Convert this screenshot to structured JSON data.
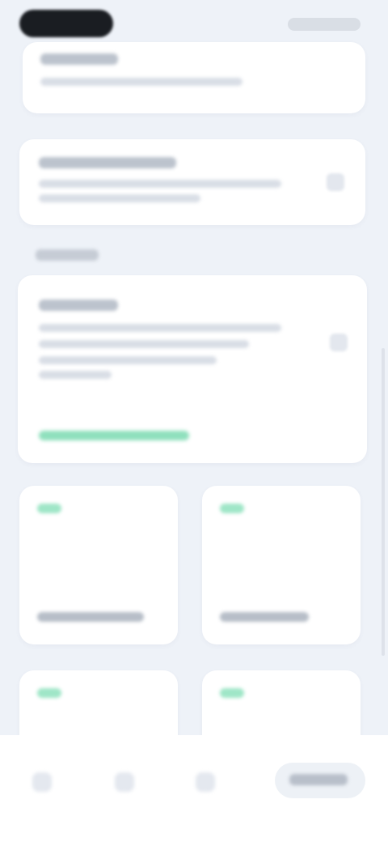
{
  "status_bar": {
    "time_pill": "",
    "icons": [
      "signal-icon",
      "wifi-icon",
      "battery-icon"
    ]
  },
  "cards": [
    {
      "title": "",
      "subtitle": ""
    },
    {
      "title": "",
      "subtitle": "",
      "chevron": "chevron-icon"
    }
  ],
  "section": {
    "label": ""
  },
  "wallet_card": {
    "title": "",
    "description": "",
    "link": ""
  },
  "tiles": [
    {
      "tag": "",
      "title": ""
    },
    {
      "tag": "",
      "title": ""
    },
    {
      "tag": "",
      "title": ""
    },
    {
      "tag": "",
      "title": ""
    }
  ],
  "bottom_nav": {
    "items": [
      "home-icon",
      "chart-icon",
      "grid-icon"
    ],
    "active_label": ""
  },
  "colors": {
    "background": "#eef2f8",
    "card": "#ffffff",
    "accent": "#8fe0bd",
    "status_pill": "#1a1d22"
  }
}
